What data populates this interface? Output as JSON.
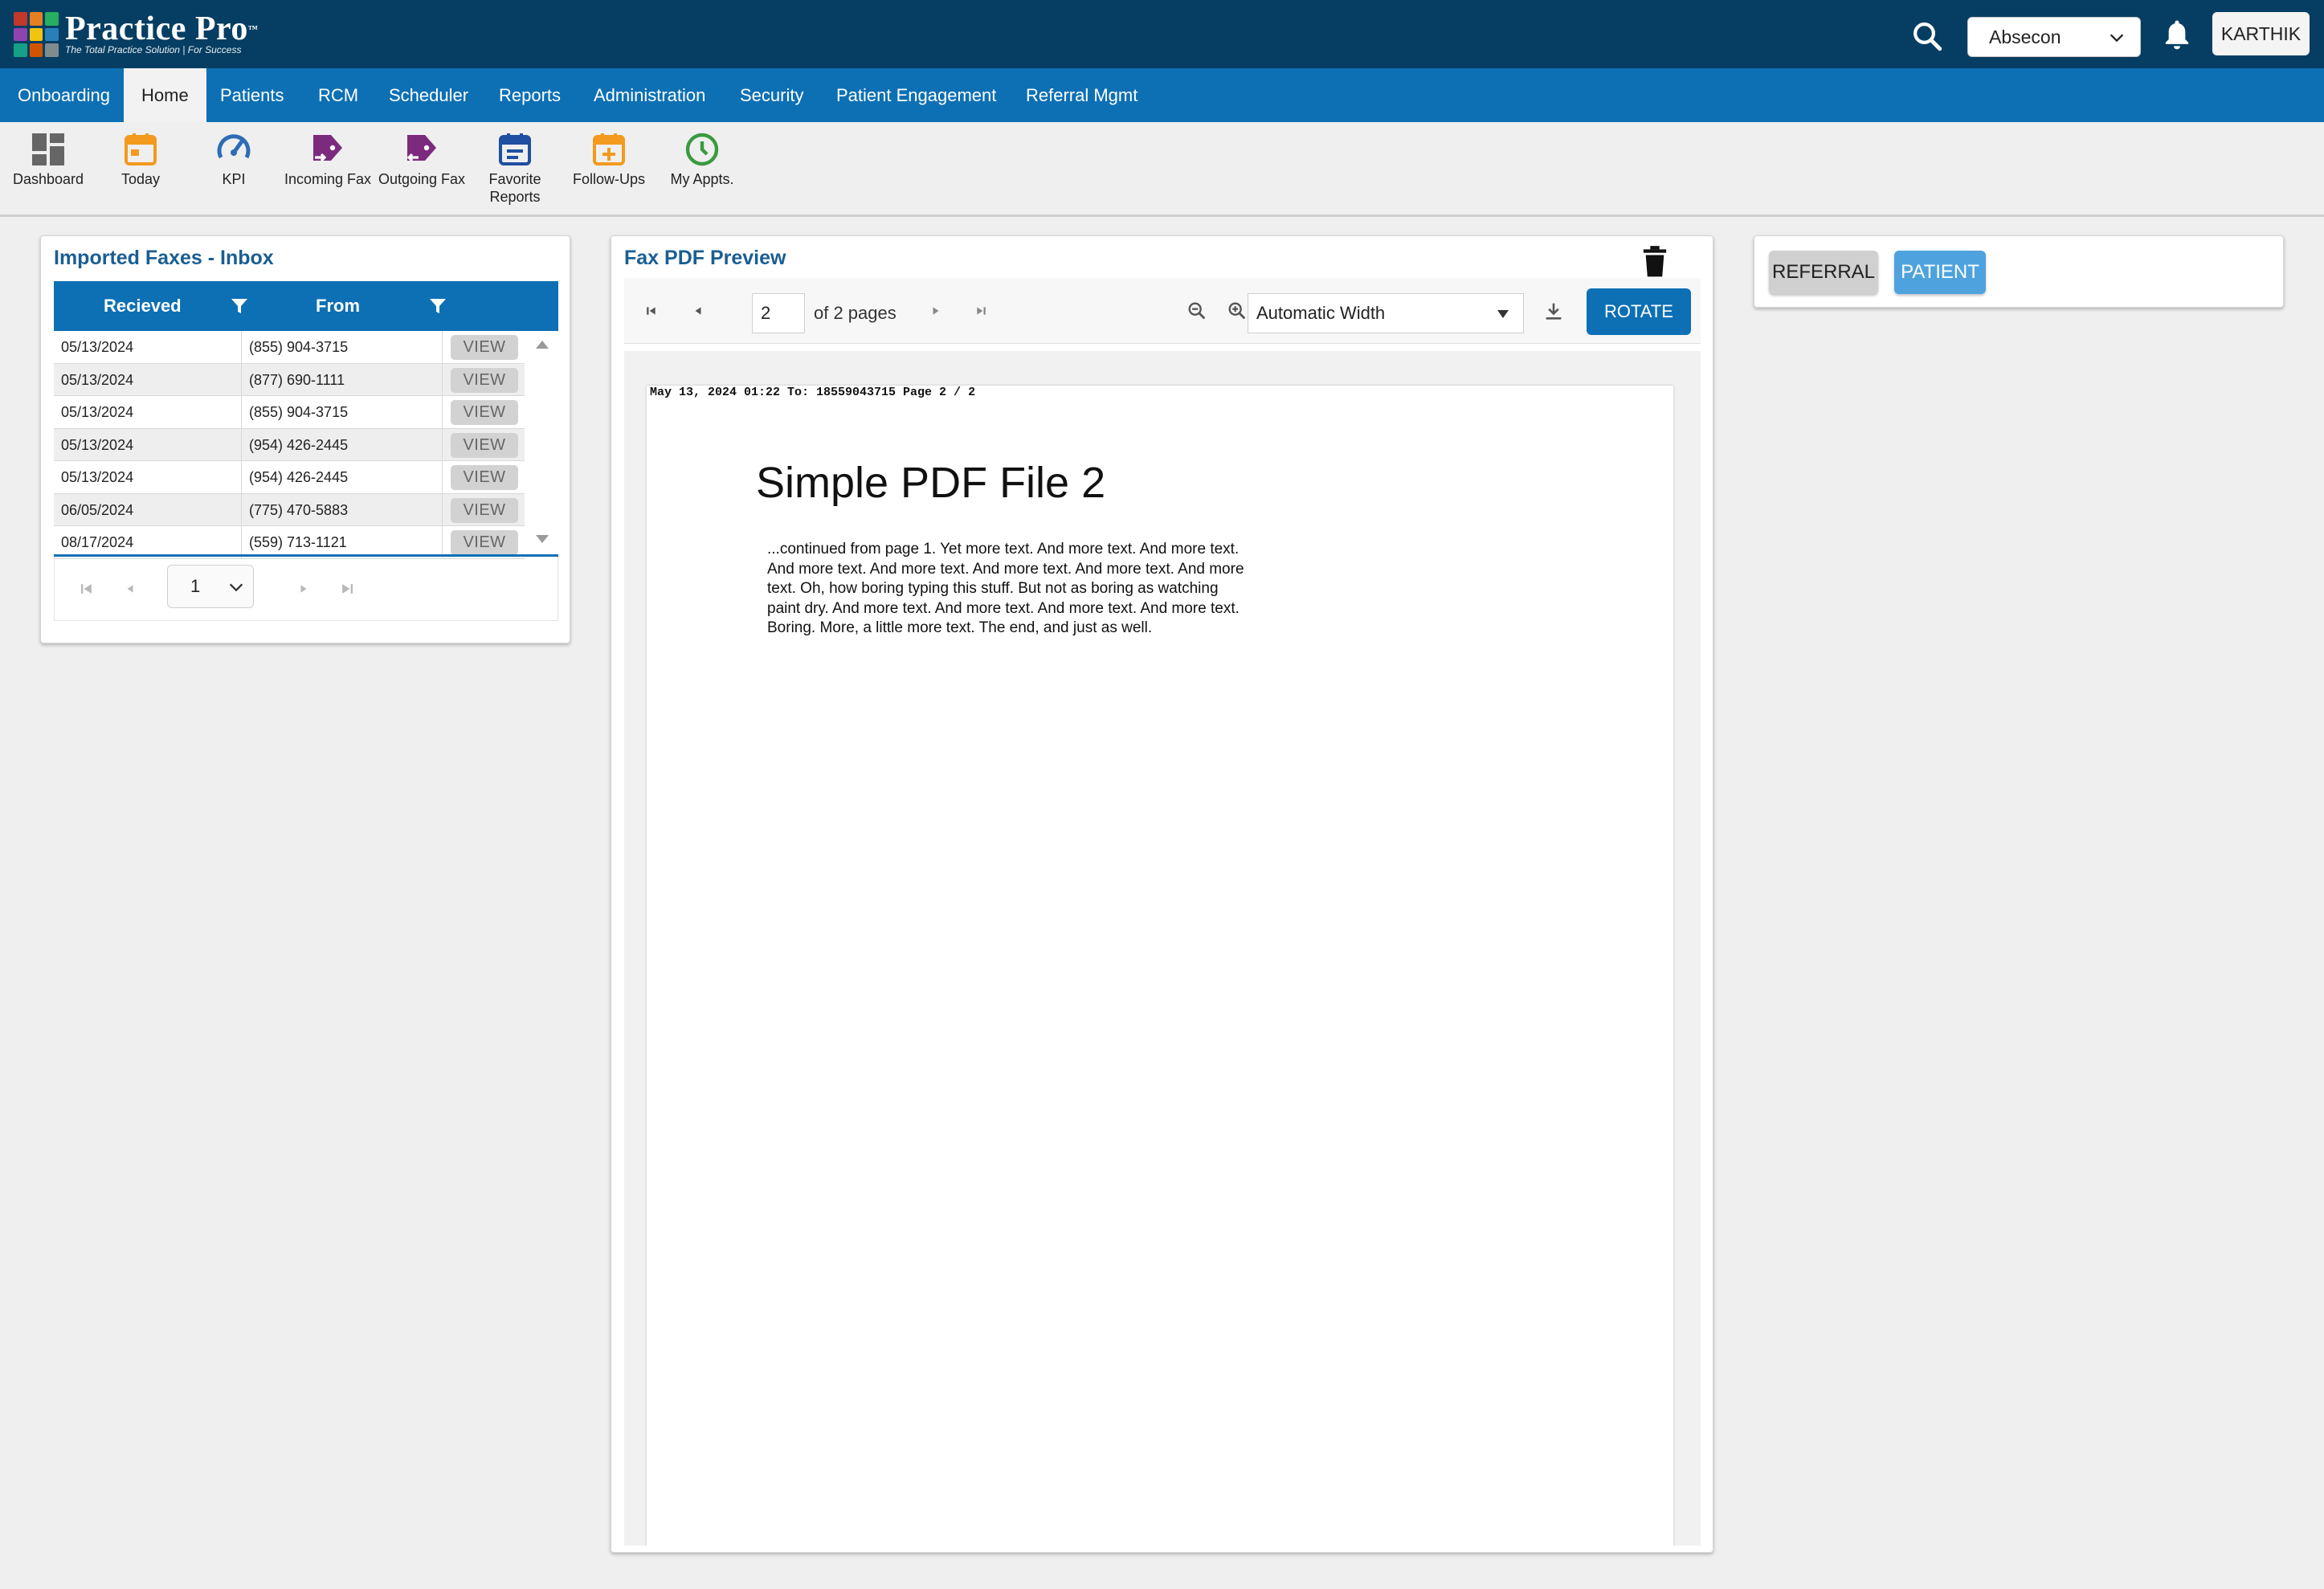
{
  "app": {
    "logo_title": "Practice Pro",
    "logo_trademark": "™",
    "logo_tagline": "The Total Practice Solution | For Success",
    "location": "Absecon",
    "user": "KARTHIK"
  },
  "nav": {
    "items": [
      {
        "label": "Onboarding"
      },
      {
        "label": "Home"
      },
      {
        "label": "Patients"
      },
      {
        "label": "RCM"
      },
      {
        "label": "Scheduler"
      },
      {
        "label": "Reports"
      },
      {
        "label": "Administration"
      },
      {
        "label": "Security"
      },
      {
        "label": "Patient Engagement"
      },
      {
        "label": "Referral Mgmt"
      }
    ],
    "active": "Home"
  },
  "toolbar": {
    "items": [
      {
        "label": "Dashboard",
        "icon": "dashboard-icon"
      },
      {
        "label": "Today",
        "icon": "calendar-today-icon"
      },
      {
        "label": "KPI",
        "icon": "speedometer-icon"
      },
      {
        "label": "Incoming Fax",
        "icon": "incoming-fax-icon"
      },
      {
        "label": "Outgoing Fax",
        "icon": "outgoing-fax-icon"
      },
      {
        "label": "Favorite Reports",
        "icon": "report-calendar-icon"
      },
      {
        "label": "Follow-Ups",
        "icon": "calendar-add-icon"
      },
      {
        "label": "My Appts.",
        "icon": "clock-icon"
      }
    ]
  },
  "inbox": {
    "title": "Imported Faxes - Inbox",
    "columns": [
      "Recieved",
      "From"
    ],
    "view_label": "VIEW",
    "rows": [
      {
        "received": "05/13/2024",
        "from": "(855) 904-3715"
      },
      {
        "received": "05/13/2024",
        "from": "(877) 690-1111"
      },
      {
        "received": "05/13/2024",
        "from": "(855) 904-3715"
      },
      {
        "received": "05/13/2024",
        "from": "(954) 426-2445"
      },
      {
        "received": "05/13/2024",
        "from": "(954) 426-2445"
      },
      {
        "received": "06/05/2024",
        "from": "(775) 470-5883"
      },
      {
        "received": "08/17/2024",
        "from": "(559) 713-1121"
      }
    ],
    "page": "1"
  },
  "preview": {
    "title": "Fax PDF Preview",
    "current_page": "2",
    "page_count_text": "of 2 pages",
    "zoom": "Automatic Width",
    "rotate_label": "ROTATE",
    "fax_header": "May 13, 2024 01:22 To: 18559043715 Page 2 / 2",
    "pdf_heading": "Simple PDF File 2",
    "pdf_lines": [
      "...continued from page 1. Yet more text. And more text. And more text.",
      "And more text. And more text. And more text. And more text. And more",
      "text. Oh, how boring typing this stuff. But not as boring as watching",
      "paint dry. And more text. And more text. And more text. And more text.",
      "Boring.  More, a little more text. The end, and just as well."
    ]
  },
  "actions": {
    "referral_label": "REFERRAL",
    "patient_label": "PATIENT"
  },
  "colors": {
    "topbar": "#063e63",
    "nav": "#0d70b5",
    "accent_button": "#0d70b5",
    "patient_button": "#4ea3de",
    "title_text": "#1a5e92"
  }
}
